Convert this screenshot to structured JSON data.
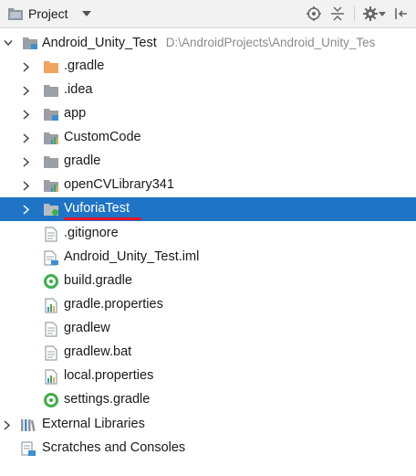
{
  "panel": {
    "title": "Project"
  },
  "tree": {
    "root": {
      "label": "Android_Unity_Test",
      "path": "D:\\AndroidProjects\\Android_Unity_Tes"
    },
    "items": [
      {
        "label": ".gradle",
        "icon": "folder-orange-icon"
      },
      {
        "label": ".idea",
        "icon": "folder-icon"
      },
      {
        "label": "app",
        "icon": "module-folder-icon"
      },
      {
        "label": "CustomCode",
        "icon": "module-chart-folder-icon"
      },
      {
        "label": "gradle",
        "icon": "folder-icon"
      },
      {
        "label": "openCVLibrary341",
        "icon": "module-chart-folder-icon"
      },
      {
        "label": "VuforiaTest",
        "icon": "module-green-folder-icon"
      }
    ],
    "files": [
      {
        "label": ".gitignore",
        "icon": "text-file-icon"
      },
      {
        "label": "Android_Unity_Test.iml",
        "icon": "iml-file-icon"
      },
      {
        "label": "build.gradle",
        "icon": "gradle-icon"
      },
      {
        "label": "gradle.properties",
        "icon": "properties-file-icon"
      },
      {
        "label": "gradlew",
        "icon": "text-file-icon"
      },
      {
        "label": "gradlew.bat",
        "icon": "text-file-icon"
      },
      {
        "label": "local.properties",
        "icon": "properties-file-icon"
      },
      {
        "label": "settings.gradle",
        "icon": "gradle-icon"
      }
    ],
    "external_libraries": {
      "label": "External Libraries"
    },
    "scratches": {
      "label": "Scratches and Consoles"
    }
  },
  "colors": {
    "selection": "#1f74c6",
    "underline": "#e8152a",
    "folder": "#9aa0a6",
    "folder_orange": "#f0a45d",
    "module_blue": "#3d8fd1",
    "green": "#3fae4a"
  }
}
